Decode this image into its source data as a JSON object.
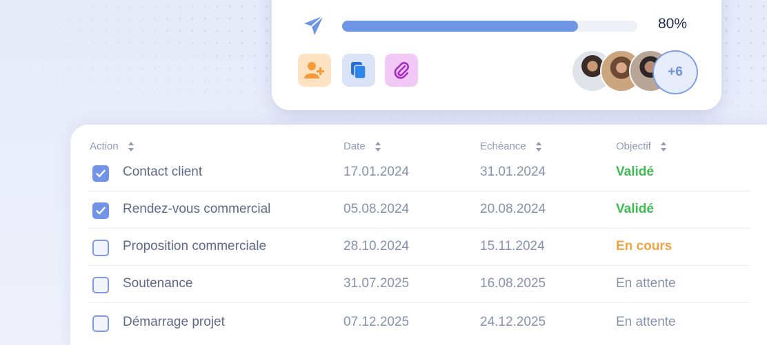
{
  "project": {
    "progress_percent": 80,
    "progress_label": "80%",
    "extra_members_label": "+6",
    "tools": [
      {
        "icon": "add-user-icon"
      },
      {
        "icon": "copy-icon"
      },
      {
        "icon": "paperclip-icon"
      }
    ]
  },
  "table": {
    "headers": {
      "action": "Action",
      "date": "Date",
      "due": "Echéance",
      "objective": "Objectif"
    },
    "rows": [
      {
        "checked": true,
        "action": "Contact client",
        "date": "17.01.2024",
        "due": "31.01.2024",
        "status": "Validé",
        "status_type": "ok"
      },
      {
        "checked": true,
        "action": "Rendez-vous commercial",
        "date": "05.08.2024",
        "due": "20.08.2024",
        "status": "Validé",
        "status_type": "ok"
      },
      {
        "checked": false,
        "action": "Proposition commerciale",
        "date": "28.10.2024",
        "due": "15.11.2024",
        "status": "En cours",
        "status_type": "progress"
      },
      {
        "checked": false,
        "action": "Soutenance",
        "date": "31.07.2025",
        "due": "16.08.2025",
        "status": "En attente",
        "status_type": "waiting"
      },
      {
        "checked": false,
        "action": "Démarrage projet",
        "date": "07.12.2025",
        "due": "24.12.2025",
        "status": "En attente",
        "status_type": "waiting"
      }
    ]
  },
  "colors": {
    "accent": "#6f96e4",
    "status_ok": "#3dbb54",
    "status_progress": "#f2a23e",
    "status_waiting": "#8691ad"
  }
}
